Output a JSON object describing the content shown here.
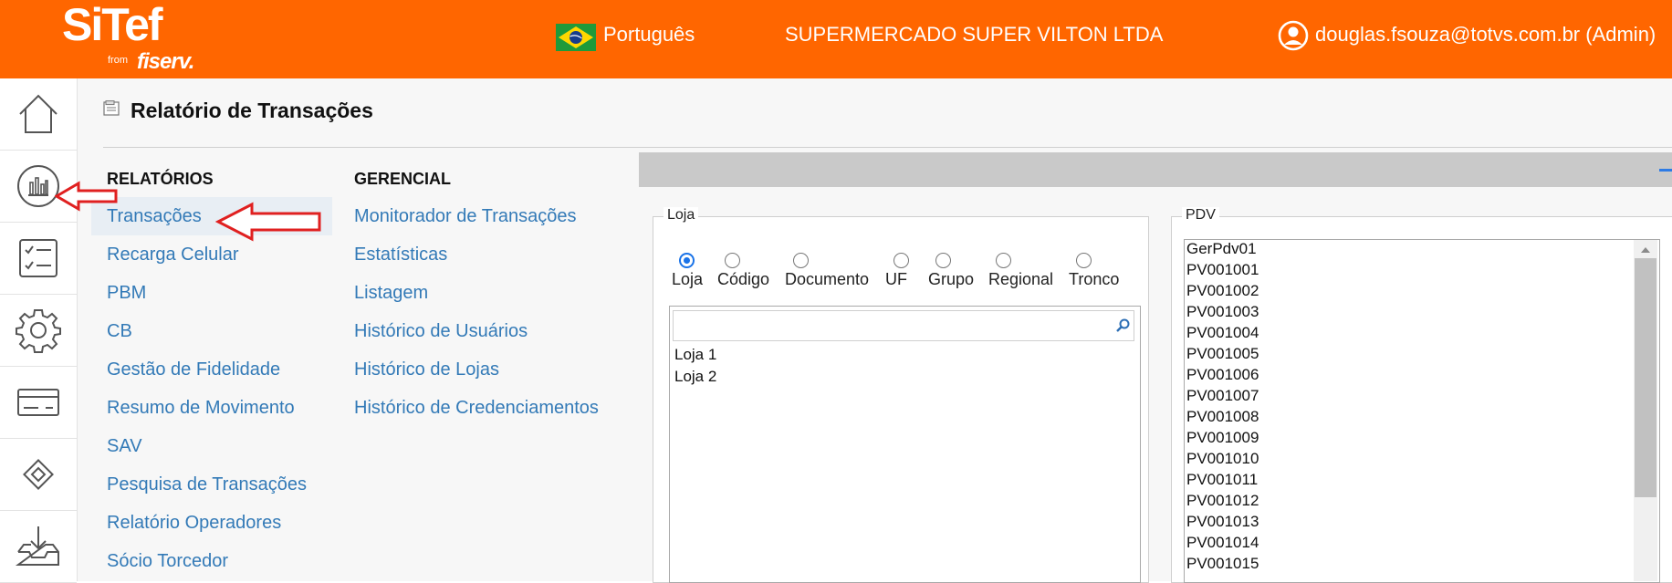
{
  "header": {
    "logo_text": "SiTef",
    "logo_from": "from",
    "logo_brand": "fiserv.",
    "language": "Português",
    "company": "SUPERMERCADO SUPER VILTON LTDA",
    "user": "douglas.fsouza@totvs.com.br (Admin)",
    "color_accent": "#ff6600"
  },
  "sidebar": {
    "items": [
      {
        "icon": "home-icon"
      },
      {
        "icon": "reports-chart-icon",
        "selected": true
      },
      {
        "icon": "checklist-icon"
      },
      {
        "icon": "gear-icon"
      },
      {
        "icon": "card-icon"
      },
      {
        "icon": "diamond-icon"
      },
      {
        "icon": "inbox-download-icon"
      }
    ]
  },
  "page": {
    "title": "Relatório de Transações"
  },
  "menu": {
    "relatorios": {
      "heading": "RELATÓRIOS",
      "items": [
        "Transações",
        "Recarga Celular",
        "PBM",
        "CB",
        "Gestão de Fidelidade",
        "Resumo de Movimento",
        "SAV",
        "Pesquisa de Transações",
        "Relatório Operadores",
        "Sócio Torcedor"
      ],
      "selected": "Transações"
    },
    "gerencial": {
      "heading": "GERENCIAL",
      "items": [
        "Monitorador de Transações",
        "Estatísticas",
        "Listagem",
        "Histórico de Usuários",
        "Histórico de Lojas",
        "Histórico de Credenciamentos"
      ]
    }
  },
  "loja": {
    "legend": "Loja",
    "options": [
      "Loja",
      "Código",
      "Documento",
      "UF",
      "Grupo",
      "Regional",
      "Tronco"
    ],
    "selected": "Loja",
    "search_placeholder": "",
    "items": [
      "Loja 1",
      "Loja 2"
    ]
  },
  "pdv": {
    "legend": "PDV",
    "items": [
      "GerPdv01",
      "PV001001",
      "PV001002",
      "PV001003",
      "PV001004",
      "PV001005",
      "PV001006",
      "PV001007",
      "PV001008",
      "PV001009",
      "PV001010",
      "PV001011",
      "PV001012",
      "PV001013",
      "PV001014",
      "PV001015"
    ]
  }
}
